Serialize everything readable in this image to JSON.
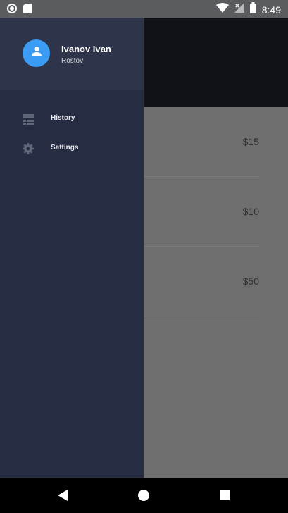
{
  "status_bar": {
    "time": "8:49",
    "icons_left": [
      "circle-icon",
      "sd-card-icon"
    ],
    "icons_right": [
      "wifi-icon",
      "signal-icon",
      "battery-icon"
    ]
  },
  "drawer": {
    "user": {
      "name": "Ivanov Ivan",
      "city": "Rostov",
      "avatar_icon": "person-icon",
      "avatar_color": "#3b9cf5"
    },
    "items": [
      {
        "label": "History",
        "icon": "history-list-icon"
      },
      {
        "label": "Settings",
        "icon": "gear-icon"
      }
    ],
    "background_color": "#262c42"
  },
  "background_list": {
    "prices": [
      "$15",
      "$10",
      "$50"
    ]
  },
  "nav_bar": {
    "buttons": [
      "back-icon",
      "home-icon",
      "recents-icon"
    ]
  }
}
